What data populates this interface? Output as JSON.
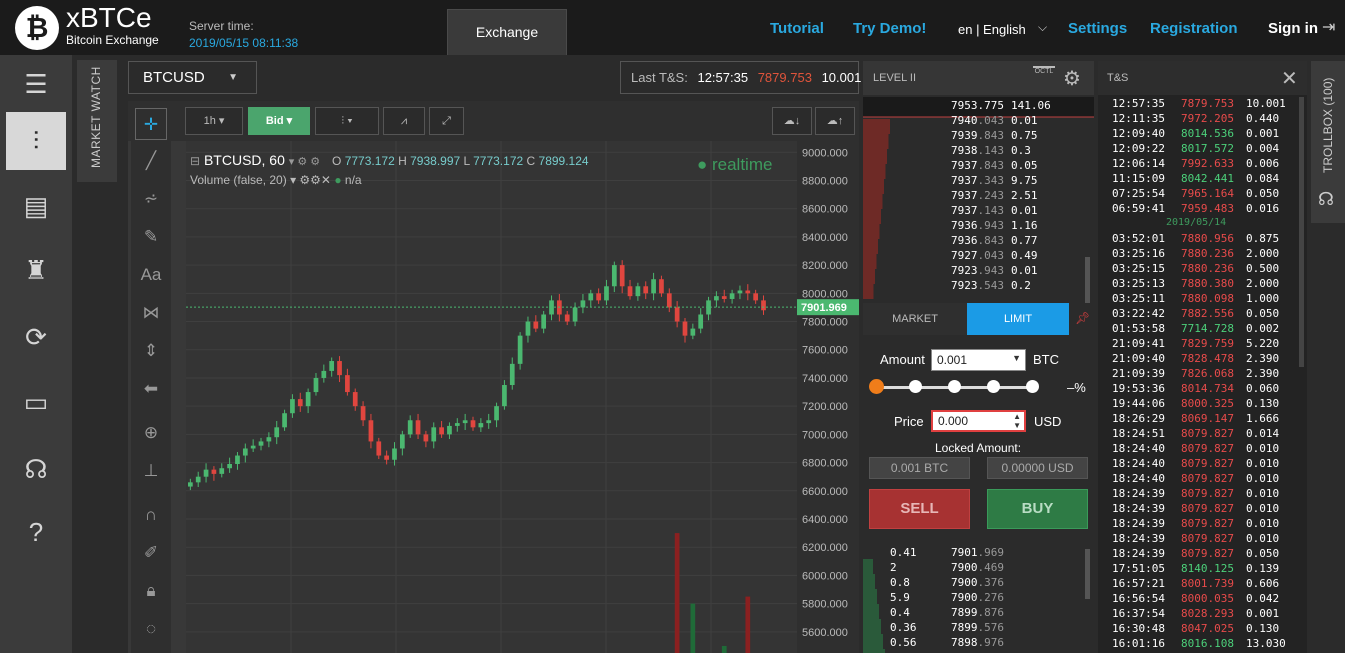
{
  "brand": {
    "logo_glyph": "₿",
    "name": "xBTCe",
    "subtitle": "Bitcoin Exchange"
  },
  "server": {
    "label": "Server time:",
    "time": "2019/05/15 08:11:38"
  },
  "tabs": {
    "exchange": "Exchange"
  },
  "nav": {
    "tutorial": "Tutorial",
    "try_demo": "Try Demo!",
    "language": "en | English",
    "settings": "Settings",
    "registration": "Registration",
    "sign_in": "Sign in"
  },
  "left_nav_icons": [
    "menu-icon",
    "trading-icon",
    "orders-icon",
    "robot-icon",
    "refresh-icon",
    "tv-icon",
    "headset-icon",
    "help-icon"
  ],
  "market_watch": "MARKET WATCH",
  "symbol": "BTCUSD",
  "last_ts": {
    "label": "Last T&S:",
    "time": "12:57:35",
    "price": "7879.753",
    "qty": "10.001"
  },
  "toolbar": {
    "interval": "1h",
    "bid": "Bid"
  },
  "chart_legend": {
    "title": "BTCUSD, 60",
    "o_label": "O",
    "o": "7773.172",
    "h_label": "H",
    "h": "7938.997",
    "l_label": "L",
    "l": "7773.172",
    "c_label": "C",
    "c": "7899.124",
    "volume": "Volume (false, 20)",
    "volume_value": "n/a",
    "realtime": "● realtime"
  },
  "chart_data": {
    "type": "candlestick",
    "ylim": [
      5450,
      9080
    ],
    "y_ticks": [
      "9000.000",
      "8800.000",
      "8600.000",
      "8400.000",
      "8200.000",
      "8000.000",
      "7800.000",
      "7600.000",
      "7400.000",
      "7200.000",
      "7000.000",
      "6800.000",
      "6600.000",
      "6400.000",
      "6200.000",
      "6000.000",
      "5800.000",
      "5600.000"
    ],
    "y_tick_values": [
      9000,
      8800,
      8600,
      8400,
      8200,
      8000,
      7800,
      7600,
      7400,
      7200,
      7000,
      6800,
      6600,
      6400,
      6200,
      6000,
      5800,
      5600
    ],
    "current_price": "7901.969",
    "current_value": 7901.969,
    "closes": [
      6660,
      6700,
      6750,
      6720,
      6760,
      6790,
      6850,
      6900,
      6920,
      6950,
      6980,
      7050,
      7150,
      7250,
      7200,
      7300,
      7400,
      7450,
      7520,
      7420,
      7300,
      7200,
      7100,
      6950,
      6850,
      6820,
      6900,
      7000,
      7100,
      7000,
      6950,
      7050,
      7000,
      7060,
      7080,
      7100,
      7050,
      7080,
      7100,
      7200,
      7350,
      7500,
      7700,
      7800,
      7750,
      7850,
      7950,
      7850,
      7800,
      7900,
      7950,
      8000,
      7950,
      8050,
      8200,
      8050,
      7980,
      8050,
      8000,
      8100,
      8000,
      7900,
      7800,
      7700,
      7750,
      7850,
      7950,
      7980,
      7960,
      8000,
      8020,
      8000,
      7950,
      7880
    ],
    "volume_bars": [
      {
        "idx": 62,
        "value": 6300,
        "color": "red"
      },
      {
        "idx": 64,
        "value": 5800,
        "color": "green"
      },
      {
        "idx": 68,
        "value": 5500,
        "color": "green"
      },
      {
        "idx": 71,
        "value": 5850,
        "color": "red"
      }
    ]
  },
  "level2": {
    "title": "LEVEL II",
    "octl": "OCTL",
    "asks": [
      {
        "price_a": "7953",
        "price_b": ".775",
        "qty": "141.06"
      },
      {
        "price_a": "7940",
        "price_b": ".043",
        "qty": "0.01"
      },
      {
        "price_a": "7939",
        "price_b": ".843",
        "qty": "0.75"
      },
      {
        "price_a": "7938",
        "price_b": ".143",
        "qty": "0.3"
      },
      {
        "price_a": "7937",
        "price_b": ".843",
        "qty": "0.05"
      },
      {
        "price_a": "7937",
        "price_b": ".343",
        "qty": "9.75"
      },
      {
        "price_a": "7937",
        "price_b": ".243",
        "qty": "2.51"
      },
      {
        "price_a": "7937",
        "price_b": ".143",
        "qty": "0.01"
      },
      {
        "price_a": "7936",
        "price_b": ".943",
        "qty": "1.16"
      },
      {
        "price_a": "7936",
        "price_b": ".843",
        "qty": "0.77"
      },
      {
        "price_a": "7927",
        "price_b": ".043",
        "qty": "0.49"
      },
      {
        "price_a": "7923",
        "price_b": ".943",
        "qty": "0.01"
      },
      {
        "price_a": "7923",
        "price_b": ".543",
        "qty": "0.2"
      }
    ],
    "bids": [
      {
        "qty": "0.41",
        "price_a": "7901",
        "price_b": ".969"
      },
      {
        "qty": "2",
        "price_a": "7900",
        "price_b": ".469"
      },
      {
        "qty": "0.8",
        "price_a": "7900",
        "price_b": ".376"
      },
      {
        "qty": "5.9",
        "price_a": "7900",
        "price_b": ".276"
      },
      {
        "qty": "0.4",
        "price_a": "7899",
        "price_b": ".876"
      },
      {
        "qty": "0.36",
        "price_a": "7899",
        "price_b": ".576"
      },
      {
        "qty": "0.56",
        "price_a": "7898",
        "price_b": ".976"
      }
    ]
  },
  "order_form": {
    "tab_market": "MARKET",
    "tab_limit": "LIMIT",
    "amount_label": "Amount",
    "amount": "0.001",
    "amount_unit": "BTC",
    "slider_pct": "–%",
    "slider_fraction": 0,
    "price_label": "Price",
    "price": "0.000",
    "price_unit": "USD",
    "locked_label": "Locked Amount:",
    "locked_btc": "0.001 BTC",
    "locked_usd": "0.00000 USD",
    "sell": "SELL",
    "buy": "BUY"
  },
  "ts": {
    "title": "T&S",
    "date_separator": "2019/05/14",
    "rows_before": [
      {
        "t": "12:57:35",
        "p": "7879.753",
        "q": "10.001",
        "dir": "dn"
      },
      {
        "t": "12:11:35",
        "p": "7972.205",
        "q": "0.440",
        "dir": "dn"
      },
      {
        "t": "12:09:40",
        "p": "8014.536",
        "q": "0.001",
        "dir": "up"
      },
      {
        "t": "12:09:22",
        "p": "8017.572",
        "q": "0.004",
        "dir": "up"
      },
      {
        "t": "12:06:14",
        "p": "7992.633",
        "q": "0.006",
        "dir": "dn"
      },
      {
        "t": "11:15:09",
        "p": "8042.441",
        "q": "0.084",
        "dir": "up"
      },
      {
        "t": "07:25:54",
        "p": "7965.164",
        "q": "0.050",
        "dir": "dn"
      },
      {
        "t": "06:59:41",
        "p": "7959.483",
        "q": "0.016",
        "dir": "dn"
      }
    ],
    "rows_after": [
      {
        "t": "03:52:01",
        "p": "7880.956",
        "q": "0.875",
        "dir": "dn"
      },
      {
        "t": "03:25:16",
        "p": "7880.236",
        "q": "2.000",
        "dir": "dn"
      },
      {
        "t": "03:25:15",
        "p": "7880.236",
        "q": "0.500",
        "dir": "dn"
      },
      {
        "t": "03:25:13",
        "p": "7880.380",
        "q": "2.000",
        "dir": "dn"
      },
      {
        "t": "03:25:11",
        "p": "7880.098",
        "q": "1.000",
        "dir": "dn"
      },
      {
        "t": "03:22:42",
        "p": "7882.556",
        "q": "0.050",
        "dir": "dn"
      },
      {
        "t": "01:53:58",
        "p": "7714.728",
        "q": "0.002",
        "dir": "up"
      },
      {
        "t": "21:09:41",
        "p": "7829.759",
        "q": "5.220",
        "dir": "dn"
      },
      {
        "t": "21:09:40",
        "p": "7828.478",
        "q": "2.390",
        "dir": "dn"
      },
      {
        "t": "21:09:39",
        "p": "7826.068",
        "q": "2.390",
        "dir": "dn"
      },
      {
        "t": "19:53:36",
        "p": "8014.734",
        "q": "0.060",
        "dir": "dn"
      },
      {
        "t": "19:44:06",
        "p": "8000.325",
        "q": "0.130",
        "dir": "dn"
      },
      {
        "t": "18:26:29",
        "p": "8069.147",
        "q": "1.666",
        "dir": "dn"
      },
      {
        "t": "18:24:51",
        "p": "8079.827",
        "q": "0.014",
        "dir": "dn"
      },
      {
        "t": "18:24:40",
        "p": "8079.827",
        "q": "0.010",
        "dir": "dn"
      },
      {
        "t": "18:24:40",
        "p": "8079.827",
        "q": "0.010",
        "dir": "dn"
      },
      {
        "t": "18:24:40",
        "p": "8079.827",
        "q": "0.010",
        "dir": "dn"
      },
      {
        "t": "18:24:39",
        "p": "8079.827",
        "q": "0.010",
        "dir": "dn"
      },
      {
        "t": "18:24:39",
        "p": "8079.827",
        "q": "0.010",
        "dir": "dn"
      },
      {
        "t": "18:24:39",
        "p": "8079.827",
        "q": "0.010",
        "dir": "dn"
      },
      {
        "t": "18:24:39",
        "p": "8079.827",
        "q": "0.010",
        "dir": "dn"
      },
      {
        "t": "18:24:39",
        "p": "8079.827",
        "q": "0.050",
        "dir": "dn"
      },
      {
        "t": "17:51:05",
        "p": "8140.125",
        "q": "0.139",
        "dir": "up"
      },
      {
        "t": "16:57:21",
        "p": "8001.739",
        "q": "0.606",
        "dir": "dn"
      },
      {
        "t": "16:56:54",
        "p": "8000.035",
        "q": "0.042",
        "dir": "dn"
      },
      {
        "t": "16:37:54",
        "p": "8028.293",
        "q": "0.001",
        "dir": "dn"
      },
      {
        "t": "16:30:48",
        "p": "8047.025",
        "q": "0.130",
        "dir": "dn"
      },
      {
        "t": "16:01:16",
        "p": "8016.108",
        "q": "13.030",
        "dir": "up"
      }
    ]
  },
  "trollbox": "TROLLBOX (100)",
  "colors": {
    "accent": "#2aa9e0",
    "up": "#4cd07a",
    "down": "#e84b4b",
    "limit_tab": "#1b9be6",
    "sell": "#a73232",
    "buy": "#2e7b45"
  }
}
